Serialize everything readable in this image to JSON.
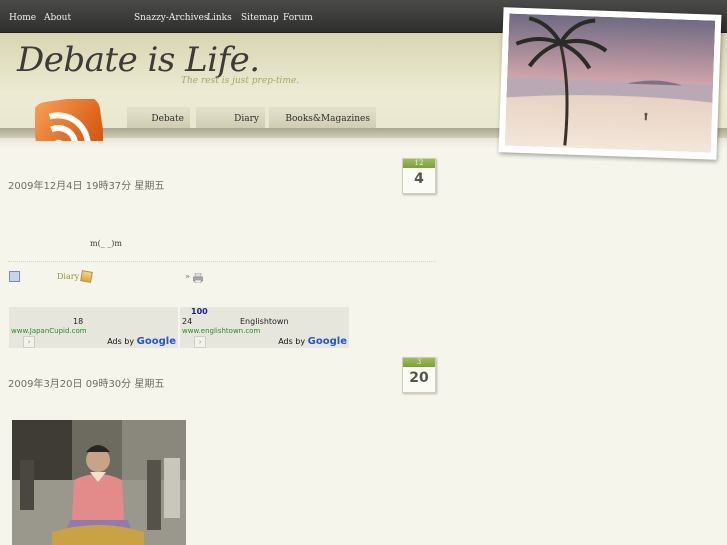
{
  "nav": {
    "home": "Home",
    "about": "About",
    "archives": "Snazzy-Archives",
    "links": "Links",
    "sitemap": "Sitemap",
    "forum": "Forum"
  },
  "header": {
    "title": "Debate is Life.",
    "tagline": "The rest is just prep-time."
  },
  "tabs": [
    "Debate",
    "Diary",
    "Books&Magazines"
  ],
  "posts": [
    {
      "date": "2009年12月4日 19時37分 星期五",
      "cal_month": "12",
      "cal_day": "4",
      "body": "m(_ _)m",
      "category": "Diary",
      "more": "»"
    },
    {
      "date": "2009年3月20日 09時30分 星期五",
      "cal_month": "3",
      "cal_day": "20"
    }
  ],
  "ads": [
    {
      "line_num": "18",
      "line_text": "",
      "url": "www.JapanCupid.com",
      "adsby_prefix": "Ads by ",
      "adsby_brand": "Google"
    },
    {
      "line_num_top": "100",
      "line_num": "24",
      "line_text": "Englishtown",
      "url": "www.englishtown.com",
      "adsby_prefix": "Ads by ",
      "adsby_brand": "Google"
    }
  ],
  "colors": {
    "accent": "#92963a",
    "calendar_top": "#8fb04a",
    "nav_bg": "#3b3b39"
  },
  "icons": [
    "rss-feed-icon",
    "document-icon",
    "folder-icon",
    "printer-icon",
    "next-arrow-icon"
  ]
}
